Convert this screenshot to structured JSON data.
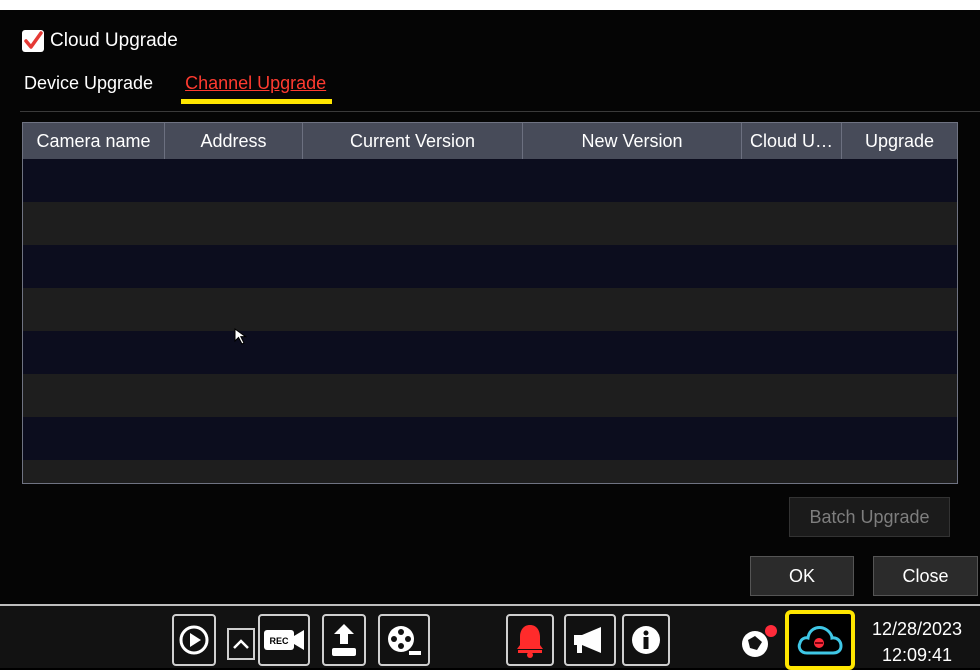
{
  "dialog": {
    "cloud_upgrade_label": "Cloud Upgrade",
    "cloud_upgrade_checked": true,
    "tabs": [
      {
        "label": "Device Upgrade",
        "active": false
      },
      {
        "label": "Channel Upgrade",
        "active": true
      }
    ]
  },
  "table": {
    "columns": [
      "Camera name",
      "Address",
      "Current Version",
      "New Version",
      "Cloud U…",
      "Upgrade"
    ],
    "rows": []
  },
  "buttons": {
    "batch_upgrade": "Batch Upgrade",
    "ok": "OK",
    "close": "Close"
  },
  "taskbar": {
    "icons": [
      "playback-icon",
      "expand-up-icon",
      "record-icon",
      "backup-icon",
      "video-reel-icon",
      "alarm-bell-icon",
      "broadcast-icon",
      "info-icon",
      "network-status-icon",
      "cloud-icon"
    ],
    "date": "12/28/2023",
    "time": "12:09:41"
  },
  "colors": {
    "accent_red": "#ff3b30",
    "highlight_yellow": "#ffe600",
    "header_bg": "#474b59",
    "cloud_cyan": "#3fc7e6"
  }
}
